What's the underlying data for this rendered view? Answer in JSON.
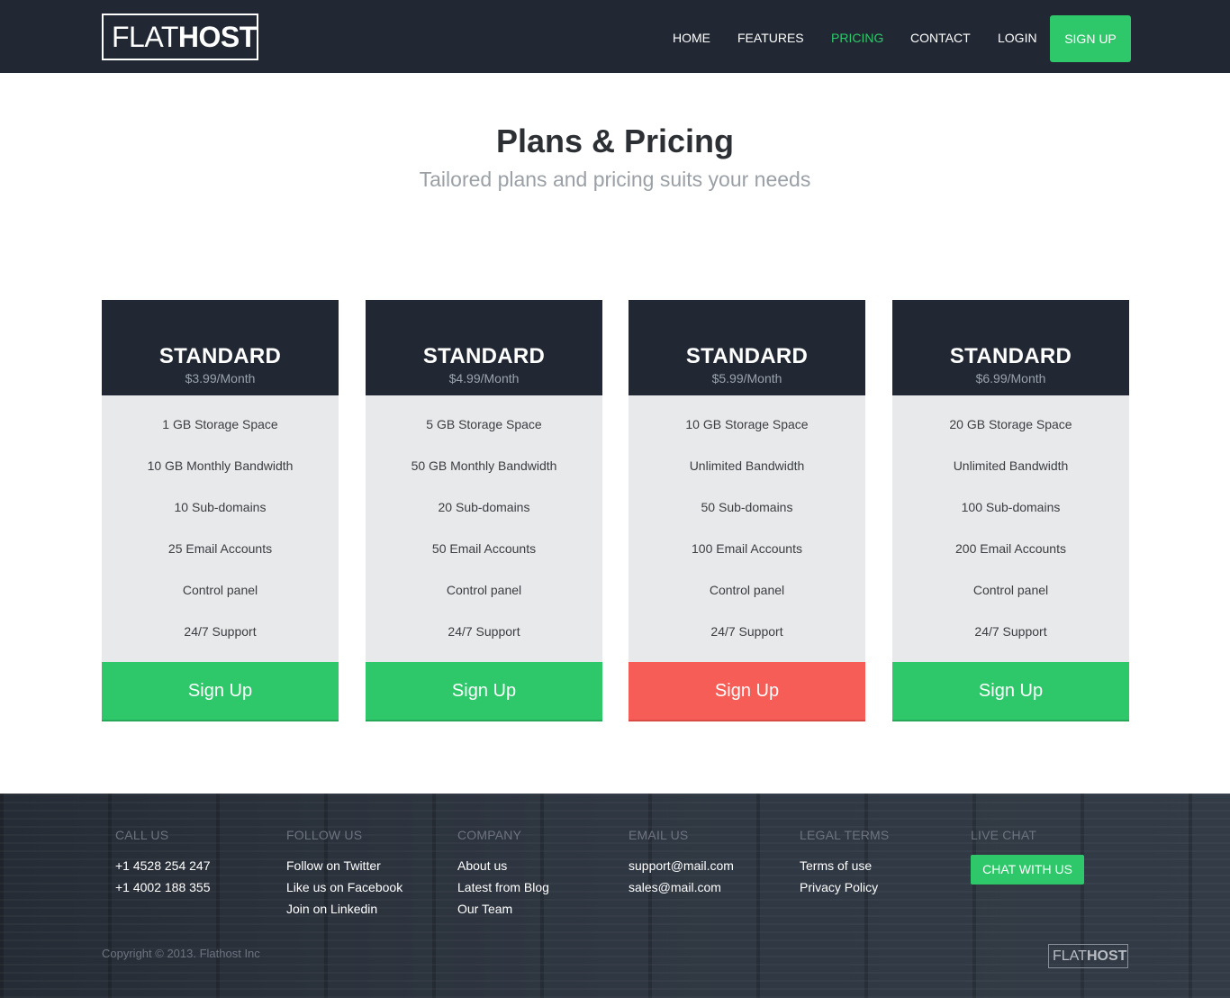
{
  "header": {
    "logo": {
      "light": "FLAT",
      "bold": "HOST"
    },
    "nav": [
      {
        "label": "HOME",
        "active": false
      },
      {
        "label": "FEATURES",
        "active": false
      },
      {
        "label": "PRICING",
        "active": true
      },
      {
        "label": "CONTACT",
        "active": false
      },
      {
        "label": "LOGIN",
        "active": false
      }
    ],
    "signup_label": "SIGN UP"
  },
  "hero": {
    "title": "Plans & Pricing",
    "subtitle": "Tailored plans and pricing suits your needs"
  },
  "plans": [
    {
      "name": "STANDARD",
      "price": "$3.99/Month",
      "features": [
        "1 GB Storage Space",
        "10 GB Monthly Bandwidth",
        "10 Sub-domains",
        "25 Email Accounts",
        "Control panel",
        "24/7 Support"
      ],
      "button": "Sign Up",
      "button_color": "#2ec86a"
    },
    {
      "name": "STANDARD",
      "price": "$4.99/Month",
      "features": [
        "5 GB Storage Space",
        "50 GB Monthly Bandwidth",
        "20 Sub-domains",
        "50 Email Accounts",
        "Control panel",
        "24/7 Support"
      ],
      "button": "Sign Up",
      "button_color": "#2ec86a"
    },
    {
      "name": "STANDARD",
      "price": "$5.99/Month",
      "features": [
        "10 GB Storage Space",
        "Unlimited Bandwidth",
        "50 Sub-domains",
        "100 Email Accounts",
        "Control panel",
        "24/7 Support"
      ],
      "button": "Sign Up",
      "button_color": "#f55d56"
    },
    {
      "name": "STANDARD",
      "price": "$6.99/Month",
      "features": [
        "20 GB Storage Space",
        "Unlimited Bandwidth",
        "100 Sub-domains",
        "200 Email Accounts",
        "Control panel",
        "24/7 Support"
      ],
      "button": "Sign Up",
      "button_color": "#2ec86a"
    }
  ],
  "footer": {
    "call_us": {
      "heading": "CALL US",
      "items": [
        "+1 4528 254 247",
        "+1 4002 188 355"
      ]
    },
    "follow_us": {
      "heading": "FOLLOW US",
      "items": [
        "Follow on Twitter",
        "Like us on Facebook",
        "Join on Linkedin"
      ]
    },
    "company": {
      "heading": "COMPANY",
      "items": [
        "About us",
        "Latest from Blog",
        "Our Team"
      ]
    },
    "email_us": {
      "heading": "EMAIL US",
      "items": [
        "support@mail.com",
        "sales@mail.com"
      ]
    },
    "legal": {
      "heading": "LEGAL TERMS",
      "items": [
        "Terms of use",
        "Privacy Policy"
      ]
    },
    "live_chat": {
      "heading": "LIVE CHAT",
      "button": "CHAT WITH US"
    },
    "copyright": "Copyright © 2013. Flathost Inc",
    "logo": {
      "light": "FLAT",
      "bold": "HOST"
    }
  },
  "colors": {
    "header_bg": "#212833",
    "accent_green": "#2ec86a",
    "accent_red": "#f55d56",
    "feature_bg": "#e8e9ea",
    "footer_bg": "#2a313b"
  }
}
